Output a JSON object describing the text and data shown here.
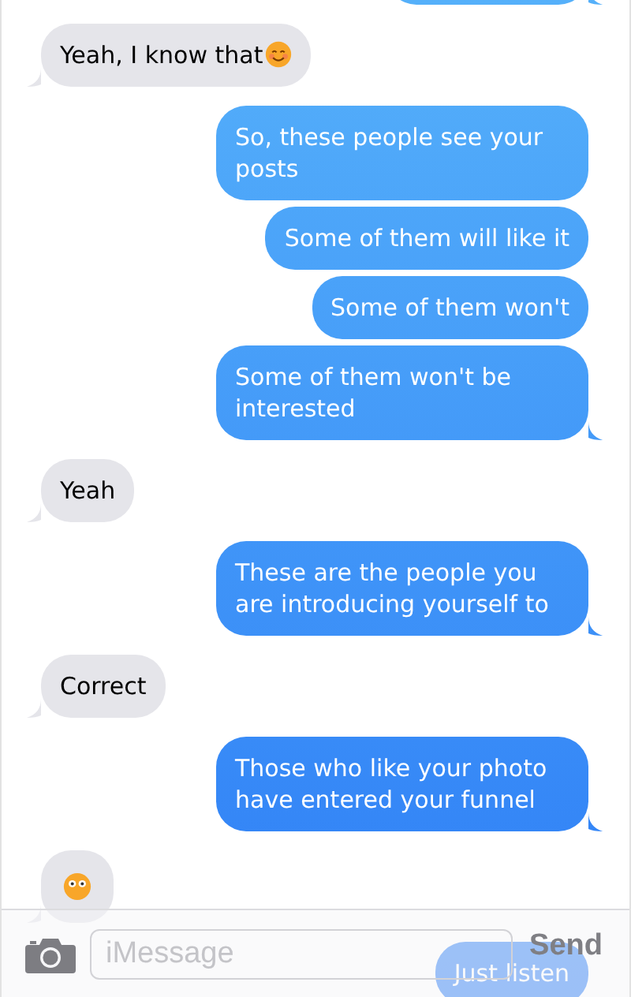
{
  "messages": [
    {
      "kind": "clipped",
      "outgoing": true,
      "tail": true
    },
    {
      "kind": "text",
      "outgoing": false,
      "text": "Yeah, I know that",
      "has_emoji": true,
      "tail": true
    },
    {
      "kind": "text",
      "outgoing": true,
      "text": "So, these people see your posts",
      "tail": false
    },
    {
      "kind": "text",
      "outgoing": true,
      "text": "Some of them will like it",
      "tail": false
    },
    {
      "kind": "text",
      "outgoing": true,
      "text": "Some of them won't",
      "tail": false
    },
    {
      "kind": "text",
      "outgoing": true,
      "text": "Some of them won't be interested",
      "tail": true
    },
    {
      "kind": "text",
      "outgoing": false,
      "text": "Yeah",
      "tail": true
    },
    {
      "kind": "text",
      "outgoing": true,
      "text": "These are the people you are introducing yourself to",
      "tail": true
    },
    {
      "kind": "text",
      "outgoing": false,
      "text": "Correct",
      "tail": true
    },
    {
      "kind": "text",
      "outgoing": true,
      "text": "Those who like your photo have entered your funnel",
      "tail": true
    },
    {
      "kind": "emoji",
      "outgoing": false,
      "tail": true
    },
    {
      "kind": "text",
      "outgoing": true,
      "text": "Just listen",
      "tail": false
    }
  ],
  "compose": {
    "placeholder": "iMessage",
    "send": "Send"
  }
}
